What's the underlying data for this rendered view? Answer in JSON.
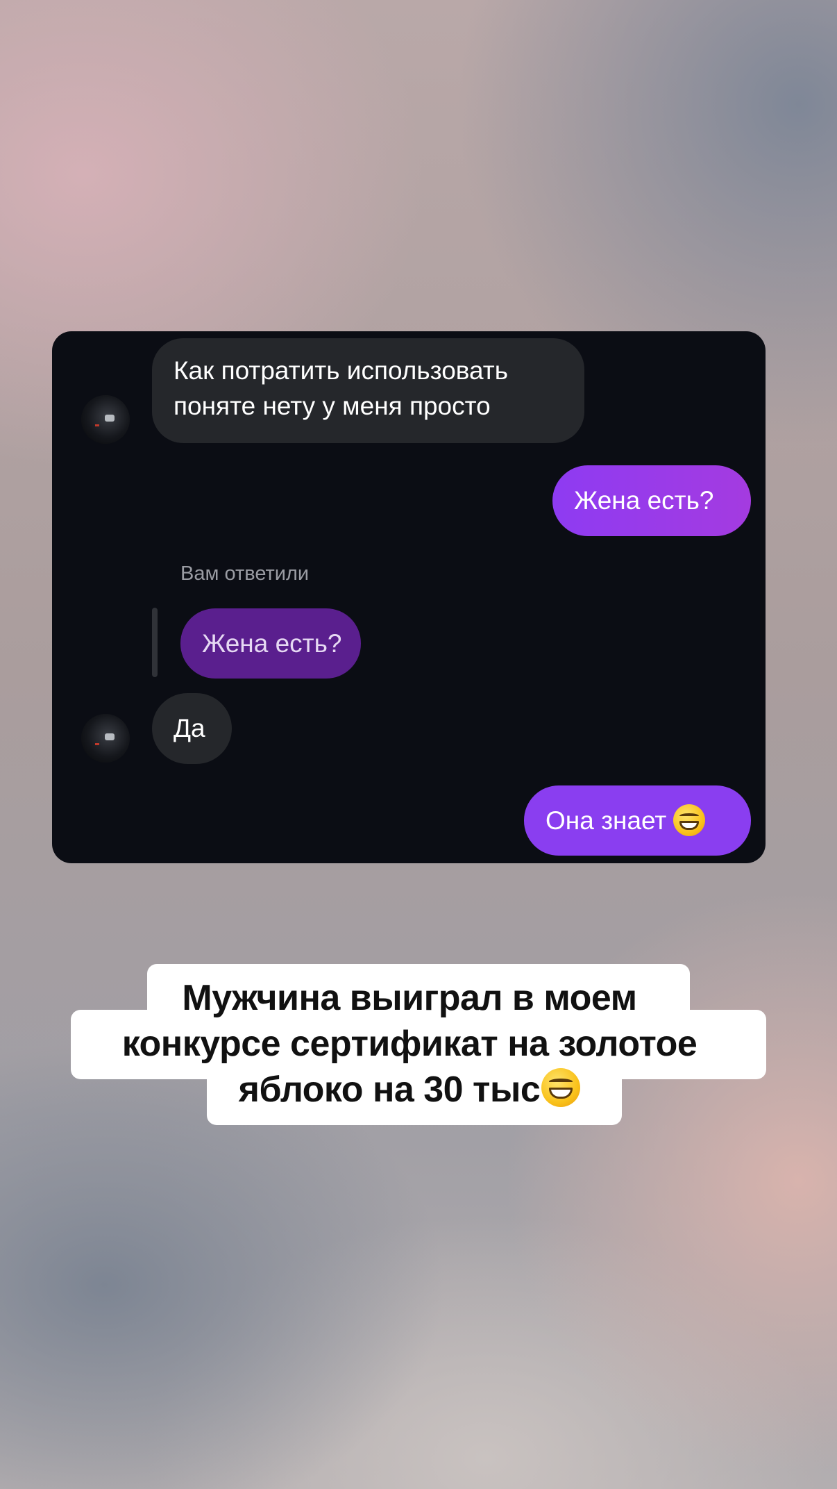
{
  "chat": {
    "messages": [
      {
        "side": "incoming",
        "lines": [
          "Как потратить использовать",
          "поняте нету у меня просто"
        ]
      },
      {
        "side": "outgoing",
        "text": "Жена есть?"
      },
      {
        "side": "incoming",
        "reply_label": "Вам ответили",
        "quoted": "Жена есть?",
        "text": "Да"
      },
      {
        "side": "outgoing",
        "text": "Она знает",
        "emoji": "grinning-face-emoji"
      }
    ]
  },
  "caption": {
    "lines": [
      "Мужчина выиграл в моем",
      "конкурсе сертификат на золотое",
      "яблоко на 30 тыс"
    ],
    "emoji": "grinning-face-emoji"
  },
  "colors": {
    "card_background": "#0b0d14",
    "incoming_bubble": "#25272b",
    "outgoing_bubble": "#9b3bea",
    "quoted_bubble": "#5a1f8e",
    "caption_background": "#ffffff"
  }
}
